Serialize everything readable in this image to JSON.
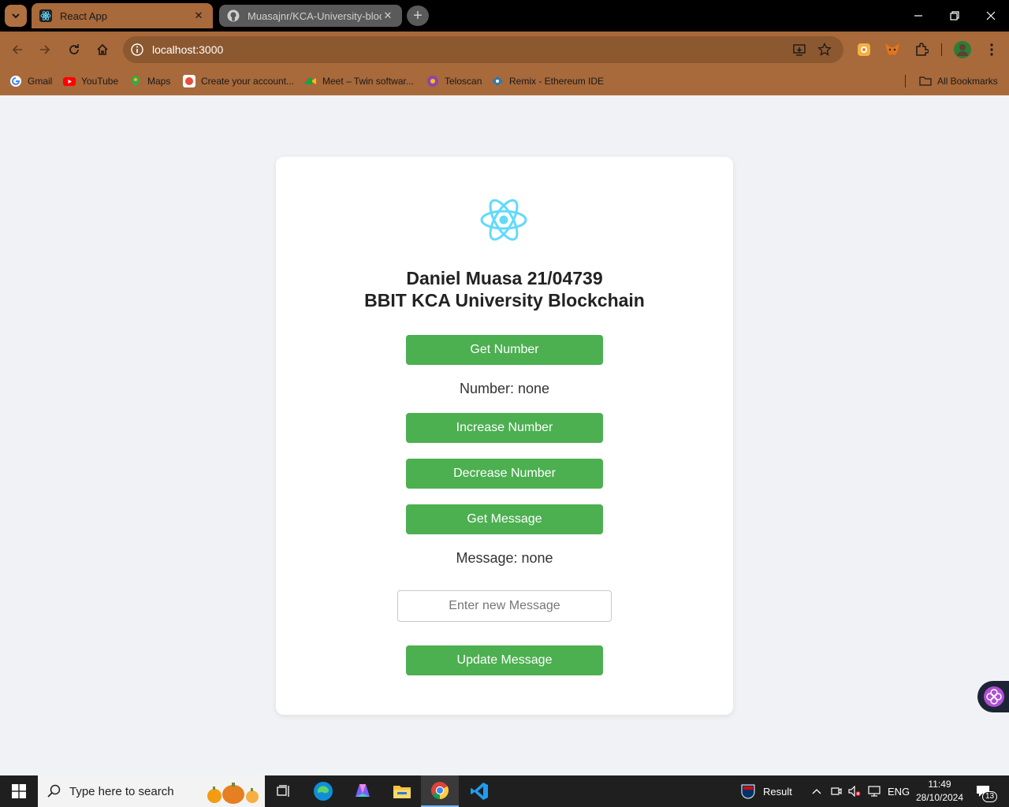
{
  "browser": {
    "tabs": [
      {
        "title": "React App",
        "active": true
      },
      {
        "title": "Muasajnr/KCA-University-block",
        "active": false
      }
    ],
    "url": "localhost:3000",
    "bookmarks": [
      {
        "label": "Gmail",
        "icon": "gmail-icon"
      },
      {
        "label": "YouTube",
        "icon": "youtube-icon"
      },
      {
        "label": "Maps",
        "icon": "maps-icon"
      },
      {
        "label": "Create your account...",
        "icon": "account-icon"
      },
      {
        "label": "Meet – Twin softwar...",
        "icon": "meet-icon"
      },
      {
        "label": "Teloscan",
        "icon": "teloscan-icon"
      },
      {
        "label": "Remix - Ethereum IDE",
        "icon": "remix-icon"
      }
    ],
    "all_bookmarks": "All Bookmarks",
    "theme_color": "#a8693b"
  },
  "app": {
    "name_line": "Daniel Muasa 21/04739",
    "course_line": "BBIT KCA University Blockchain",
    "get_number_label": "Get Number",
    "number_readout": "Number: none",
    "increase_label": "Increase Number",
    "decrease_label": "Decrease Number",
    "get_message_label": "Get Message",
    "message_readout": "Message: none",
    "message_placeholder": "Enter new Message",
    "update_label": "Update Message",
    "button_color": "#4caf50"
  },
  "taskbar": {
    "search_placeholder": "Type here to search",
    "weather_text": "Result",
    "language": "ENG",
    "time": "11:49",
    "date": "28/10/2024",
    "notifications": "13"
  }
}
